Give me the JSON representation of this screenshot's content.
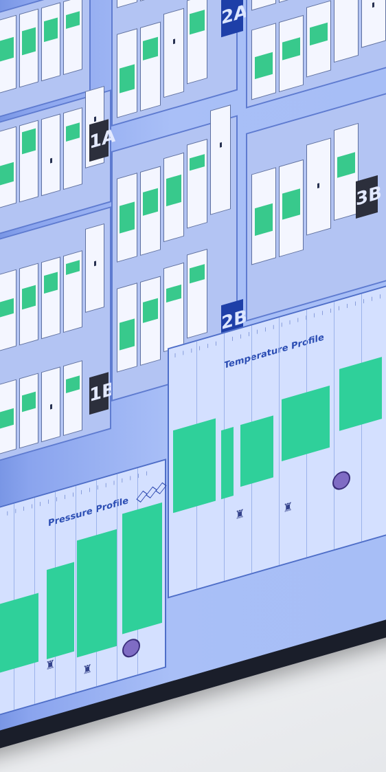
{
  "panels": {
    "labels": [
      "1A",
      "1B",
      "2A",
      "2B",
      "3B"
    ]
  },
  "profiles": {
    "pressure_title": "Pressure Profile",
    "temperature_title": "Temperature Profile"
  },
  "colors": {
    "screen_background": "#a9bff7",
    "cabinet_fill": "#38c98c",
    "profile_bar": "#2fd09a",
    "label_dark": "#2c2f3c",
    "label_blue": "#1e3fa8"
  }
}
